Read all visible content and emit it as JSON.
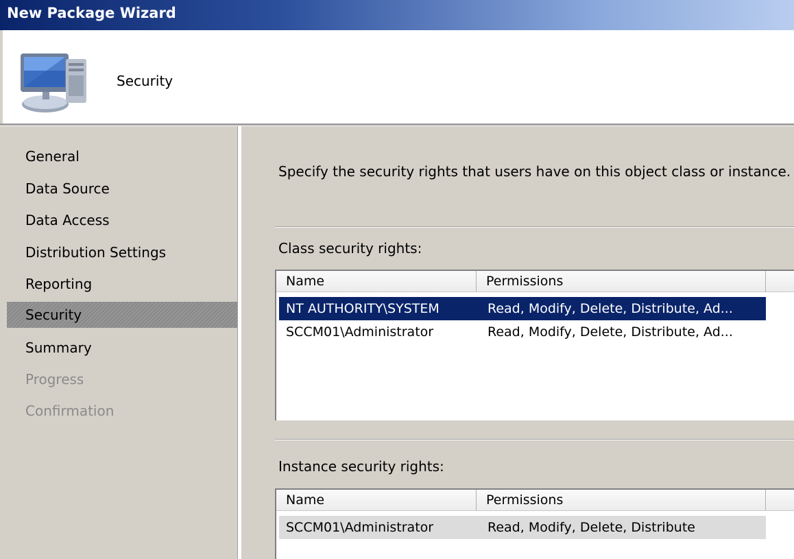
{
  "window": {
    "title": "New Package Wizard"
  },
  "header": {
    "page_name": "Security",
    "icon": "computer-icon"
  },
  "sidebar": {
    "items": [
      {
        "label": "General",
        "state": "normal"
      },
      {
        "label": "Data Source",
        "state": "normal"
      },
      {
        "label": "Data Access",
        "state": "normal"
      },
      {
        "label": "Distribution Settings",
        "state": "normal"
      },
      {
        "label": "Reporting",
        "state": "normal"
      },
      {
        "label": "Security",
        "state": "active"
      },
      {
        "label": "Summary",
        "state": "normal"
      },
      {
        "label": "Progress",
        "state": "disabled"
      },
      {
        "label": "Confirmation",
        "state": "disabled"
      }
    ]
  },
  "main": {
    "instructions": "Specify the security rights that users have on this object class or instance.",
    "class_rights": {
      "label": "Class security rights:",
      "columns": [
        "Name",
        "Permissions"
      ],
      "rows": [
        {
          "name": "NT AUTHORITY\\SYSTEM",
          "permissions": "Read, Modify, Delete, Distribute, Ad...",
          "selected": true
        },
        {
          "name": "SCCM01\\Administrator",
          "permissions": "Read, Modify, Delete, Distribute, Ad...",
          "selected": false
        }
      ]
    },
    "instance_rights": {
      "label": "Instance security rights:",
      "columns": [
        "Name",
        "Permissions"
      ],
      "rows": [
        {
          "name": "SCCM01\\Administrator",
          "permissions": "Read, Modify, Delete, Distribute",
          "selected": false
        }
      ]
    }
  },
  "colors": {
    "title_bar": "#0a246a",
    "selection": "#0a246a",
    "dialog_face": "#d4d0c8"
  }
}
